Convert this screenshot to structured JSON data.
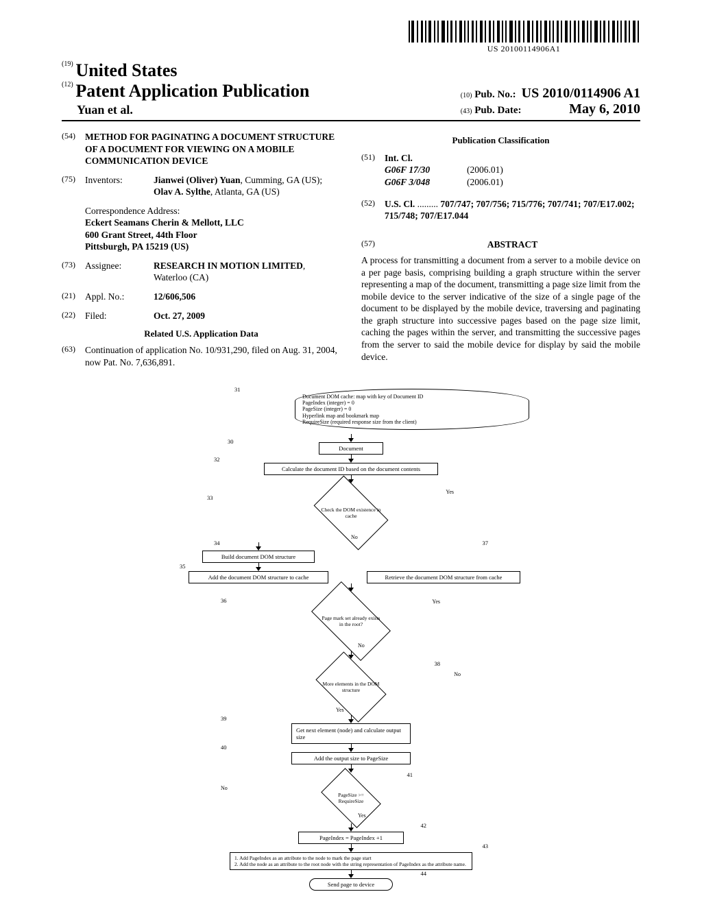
{
  "barcode_text": "US 20100114906A1",
  "header": {
    "country_num": "(19)",
    "country": "United States",
    "pub_num": "(12)",
    "pub_title": "Patent Application Publication",
    "author_line": "Yuan et al.",
    "pubno_num": "(10)",
    "pubno_label": "Pub. No.:",
    "pubno_val": "US 2010/0114906 A1",
    "pubdate_num": "(43)",
    "pubdate_label": "Pub. Date:",
    "pubdate_val": "May 6, 2010"
  },
  "left": {
    "title_num": "(54)",
    "title": "METHOD FOR PAGINATING A DOCUMENT STRUCTURE OF A DOCUMENT FOR VIEWING ON A MOBILE COMMUNICATION DEVICE",
    "inventors_num": "(75)",
    "inventors_label": "Inventors:",
    "inventors_html": "Jianwei (Oliver) Yuan, Cumming, GA (US); Olav A. Sylthe, Atlanta, GA (US)",
    "inventor1": "Jianwei (Oliver) Yuan",
    "inventor1_loc": ", Cumming, GA (US); ",
    "inventor2": "Olav A. Sylthe",
    "inventor2_loc": ", Atlanta, GA (US)",
    "corr_label": "Correspondence Address:",
    "corr_name": "Eckert Seamans Cherin & Mellott, LLC",
    "corr_addr1": "600 Grant Street, 44th Floor",
    "corr_addr2": "Pittsburgh, PA 15219 (US)",
    "assignee_num": "(73)",
    "assignee_label": "Assignee:",
    "assignee_name": "RESEARCH IN MOTION LIMITED",
    "assignee_loc": ", Waterloo (CA)",
    "applno_num": "(21)",
    "applno_label": "Appl. No.:",
    "applno_val": "12/606,506",
    "filed_num": "(22)",
    "filed_label": "Filed:",
    "filed_val": "Oct. 27, 2009",
    "related_head": "Related U.S. Application Data",
    "continuation_num": "(63)",
    "continuation_text": "Continuation of application No. 10/931,290, filed on Aug. 31, 2004, now Pat. No. 7,636,891."
  },
  "right": {
    "class_head": "Publication Classification",
    "intcl_num": "(51)",
    "intcl_label": "Int. Cl.",
    "intcl": [
      {
        "code": "G06F 17/30",
        "date": "(2006.01)"
      },
      {
        "code": "G06F 3/048",
        "date": "(2006.01)"
      }
    ],
    "uscl_num": "(52)",
    "uscl_label": "U.S. Cl.",
    "uscl_dots": " .........",
    "uscl_val": "707/747; 707/756; 715/776; 707/741; 707/E17.002; 715/748; 707/E17.044",
    "abstract_num": "(57)",
    "abstract_label": "ABSTRACT",
    "abstract_text": "A process for transmitting a document from a server to a mobile device on a per page basis, comprising building a graph structure within the server representing a map of the document, transmitting a page size limit from the mobile device to the server indicative of the size of a single page of the document to be displayed by the mobile device, traversing and paginating the graph structure into successive pages based on the page size limit, caching the pages within the server, and transmitting the successive pages from the server to said the mobile device for display by said the mobile device."
  },
  "flowchart": {
    "note": "Document DOM cache: map with key of Document ID\nPageIndex (integer) = 0\nPageSize (integer) = 0\nHyperlink map and bookmark map\nRequireSize (required response size from the client)",
    "refs": {
      "r30": "30",
      "r31": "31",
      "r32": "32",
      "r33": "33",
      "r34": "34",
      "r35": "35",
      "r36": "36",
      "r37": "37",
      "r38": "38",
      "r39": "39",
      "r40": "40",
      "r41": "41",
      "r42": "42",
      "r43": "43",
      "r44": "44"
    },
    "n30": "Document",
    "n32": "Calculate the document ID based on the document contents",
    "n33": "Check the DOM existence in cache",
    "n34": "Build document DOM structure",
    "n35": "Add the document DOM structure to cache",
    "n37": "Retrieve the document DOM structure from cache",
    "n36": "Page mark set already exists in the root?",
    "n38": "More elements in the DOM structure",
    "n39": "Get next element (node) and calculate output size",
    "n40": "Add the output size to PageSize",
    "n41": "PageSize >= RequireSize",
    "n42": "PageIndex = PageIndex +1",
    "n43": "1.    Add PageIndex as an attribute to the node to mark the page start\n2.    Add the node as an attribute to the root node with the string representation of PageIndex as the attribute name.",
    "n44": "Send page to device",
    "yes": "Yes",
    "no": "No"
  }
}
